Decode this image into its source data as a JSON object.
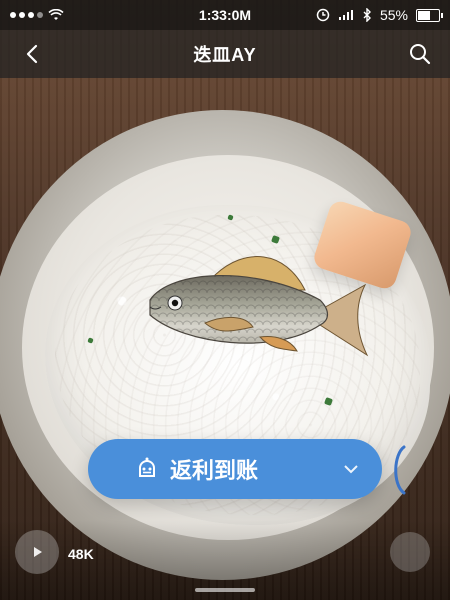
{
  "status_bar": {
    "time": "1:33:0M",
    "battery_percent": "55%",
    "battery_level": 0.55
  },
  "navbar": {
    "title": "迭皿AY",
    "back_icon": "chevron-left-icon",
    "search_icon": "search-icon"
  },
  "promo_pill": {
    "label": "返利到账",
    "icon": "robot-icon",
    "chevron": "chevron-down-icon",
    "color": "#4a8fda"
  },
  "bottom": {
    "views": "48K",
    "play_icon": "play-icon"
  }
}
